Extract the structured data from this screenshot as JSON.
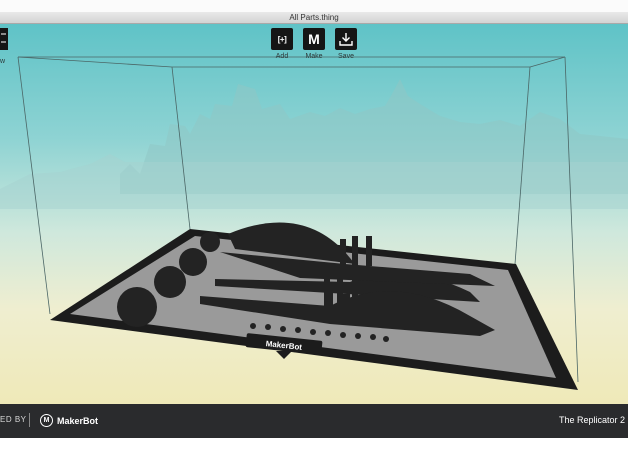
{
  "window": {
    "title": "All Parts.thing"
  },
  "toolbar": {
    "add": {
      "icon": "add-icon",
      "glyph": "[+]",
      "label": "Add"
    },
    "make": {
      "icon": "makerbot-m-icon",
      "glyph": "M",
      "label": "Make"
    },
    "save": {
      "icon": "download-icon",
      "label": "Save"
    },
    "view_label": "w"
  },
  "build_plate": {
    "logo_text": "MakerBot"
  },
  "footer": {
    "powered_by": "ED BY",
    "brand_logo": "M",
    "brand_name": "MakerBot",
    "printer_name": "The Replicator 2"
  },
  "colors": {
    "sky_top": "#5fc3c7",
    "horizon": "#efeed0",
    "plate": "#9a9a9a",
    "plate_border": "#1c1c1c",
    "parts": "#232323",
    "footer_bg": "#2a2b2d"
  }
}
